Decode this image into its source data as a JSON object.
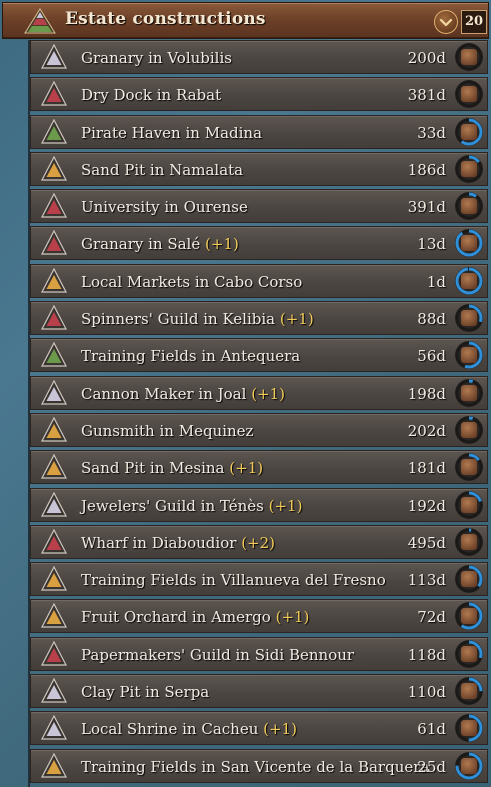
{
  "header": {
    "title": "Estate constructions",
    "count": "20"
  },
  "rows": [
    {
      "name": "Granary in Volubilis",
      "bonus": "",
      "days": "200d",
      "estate": "burghers",
      "progress": 0.0
    },
    {
      "name": "Dry Dock in Rabat",
      "bonus": "",
      "days": "381d",
      "estate": "clergy",
      "progress": 0.0
    },
    {
      "name": "Pirate Haven in Madina",
      "bonus": "",
      "days": "33d",
      "estate": "military",
      "progress": 0.6
    },
    {
      "name": "Sand Pit in Namalata",
      "bonus": "",
      "days": "186d",
      "estate": "peasants",
      "progress": 0.15
    },
    {
      "name": "University in Ourense",
      "bonus": "",
      "days": "391d",
      "estate": "clergy",
      "progress": 0.1
    },
    {
      "name": "Granary in Salé",
      "bonus": "(+1)",
      "days": "13d",
      "estate": "clergy",
      "progress": 0.9
    },
    {
      "name": "Local Markets in Cabo Corso",
      "bonus": "",
      "days": "1d",
      "estate": "peasants",
      "progress": 0.98
    },
    {
      "name": "Spinners' Guild in Kelibia",
      "bonus": "(+1)",
      "days": "88d",
      "estate": "clergy",
      "progress": 0.3
    },
    {
      "name": "Training Fields in Antequera",
      "bonus": "",
      "days": "56d",
      "estate": "military",
      "progress": 0.55
    },
    {
      "name": "Cannon Maker in Joal",
      "bonus": "(+1)",
      "days": "198d",
      "estate": "burghers",
      "progress": 0.05
    },
    {
      "name": "Gunsmith in Mequinez",
      "bonus": "",
      "days": "202d",
      "estate": "peasants",
      "progress": 0.05
    },
    {
      "name": "Sand Pit in Mesina",
      "bonus": "(+1)",
      "days": "181d",
      "estate": "peasants",
      "progress": 0.15
    },
    {
      "name": "Jewelers' Guild in Ténès",
      "bonus": "(+1)",
      "days": "192d",
      "estate": "burghers",
      "progress": 0.2
    },
    {
      "name": "Wharf in Diaboudior",
      "bonus": "(+2)",
      "days": "495d",
      "estate": "clergy",
      "progress": 0.03
    },
    {
      "name": "Training Fields in Villanueva del Fresno",
      "bonus": "",
      "days": "113d",
      "estate": "peasants",
      "progress": 0.35
    },
    {
      "name": "Fruit Orchard in Amergo",
      "bonus": "(+1)",
      "days": "72d",
      "estate": "peasants",
      "progress": 0.6
    },
    {
      "name": "Papermakers' Guild in Sidi Bennour",
      "bonus": "",
      "days": "118d",
      "estate": "clergy",
      "progress": 0.3
    },
    {
      "name": "Clay Pit in Serpa",
      "bonus": "",
      "days": "110d",
      "estate": "burghers",
      "progress": 0.25
    },
    {
      "name": "Local Shrine in Cacheu",
      "bonus": "(+1)",
      "days": "61d",
      "estate": "burghers",
      "progress": 0.5
    },
    {
      "name": "Training Fields in San Vicente de la Barquera",
      "bonus": "",
      "days": "25d",
      "estate": "peasants",
      "progress": 0.75
    }
  ],
  "colors": {
    "progress_ring": "#2f8fd8",
    "bonus_text": "#f2cc5a",
    "burghers": "#c9c4d6",
    "clergy": "#b8404a",
    "peasants": "#d8a040",
    "military": "#6a9a4a"
  }
}
